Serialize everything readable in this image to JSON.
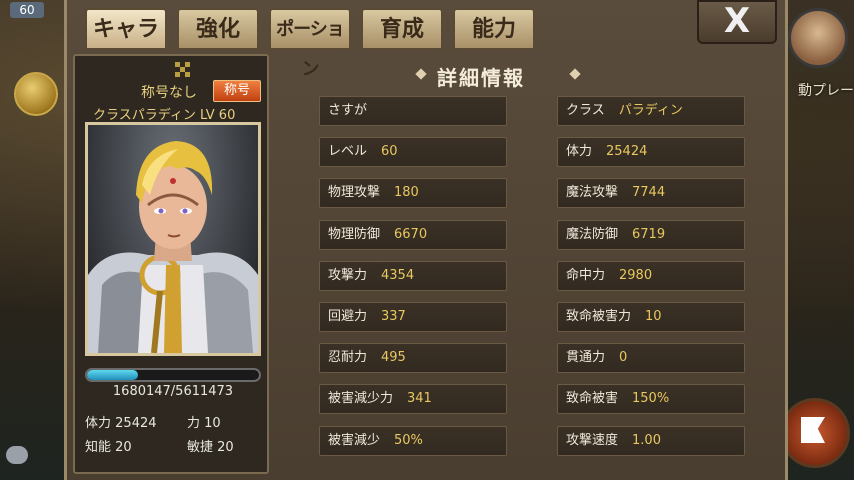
{
  "hud": {
    "level": "60",
    "right_label": "動プレー"
  },
  "tabs": [
    {
      "label": "キャラ",
      "active": true
    },
    {
      "label": "強化",
      "active": false
    },
    {
      "label": "ポーション",
      "active": false
    },
    {
      "label": "育成",
      "active": false
    },
    {
      "label": "能力",
      "active": false
    }
  ],
  "close_label": "X",
  "character": {
    "title_text": "称号なし",
    "title_button": "称号",
    "class_level": "クラスパラディン LV 60",
    "exp_text": "1680147/5611473",
    "exp_fraction": 0.299,
    "stats": {
      "hp_label": "体力",
      "hp": "25424",
      "str_label": "力",
      "str": "10",
      "int_label": "知能",
      "int": "20",
      "agi_label": "敏捷",
      "agi": "20"
    }
  },
  "detail": {
    "title": "詳細情報",
    "left": [
      {
        "label": "さすが",
        "value": ""
      },
      {
        "label": "レベル",
        "value": "60"
      },
      {
        "label": "物理攻撃",
        "value": "180"
      },
      {
        "label": "物理防御",
        "value": "6670"
      },
      {
        "label": "攻撃力",
        "value": "4354"
      },
      {
        "label": "回避力",
        "value": "337"
      },
      {
        "label": "忍耐力",
        "value": "495"
      },
      {
        "label": "被害減少力",
        "value": "341"
      },
      {
        "label": "被害減少",
        "value": "50%"
      }
    ],
    "right": [
      {
        "label": "クラス",
        "value": "パラディン"
      },
      {
        "label": "体力",
        "value": "25424"
      },
      {
        "label": "魔法攻撃",
        "value": "7744"
      },
      {
        "label": "魔法防御",
        "value": "6719"
      },
      {
        "label": "命中力",
        "value": "2980"
      },
      {
        "label": "致命被害力",
        "value": "10"
      },
      {
        "label": "貫通力",
        "value": "0"
      },
      {
        "label": "致命被害",
        "value": "150%"
      },
      {
        "label": "攻撃速度",
        "value": "1.00"
      }
    ]
  },
  "colors": {
    "accent_gold": "#e8c860",
    "exp_bar": "#40b8e0",
    "title_button": "#e06020"
  }
}
